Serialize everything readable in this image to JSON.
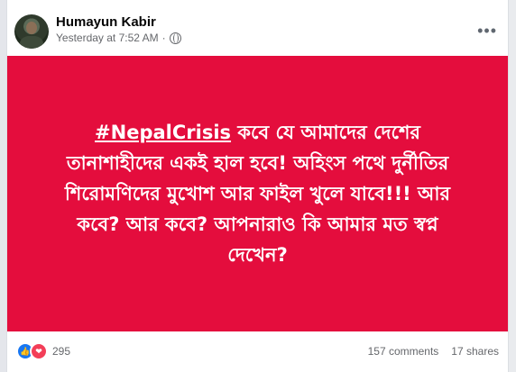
{
  "post": {
    "author": "Humayun Kabir",
    "timestamp": "Yesterday at 7:52 AM",
    "separator": "·",
    "privacy_icon": "globe-icon",
    "hashtag": "#NepalCrisis",
    "body_text": " কবে যে আমাদের দেশের তানাশাহীদের একই হাল হবে! অহিংস পথে দুর্নীতির শিরোমণিদের মুখোশ আর ফাইল খুলে যাবে!!! আর কবে? আর কবে? আপনারাও কি আমার মত স্বপ্ন দেখেন?",
    "background_color": "#e40d3d"
  },
  "engagement": {
    "reaction_count": "295",
    "comments": "157 comments",
    "shares": "17 shares"
  }
}
